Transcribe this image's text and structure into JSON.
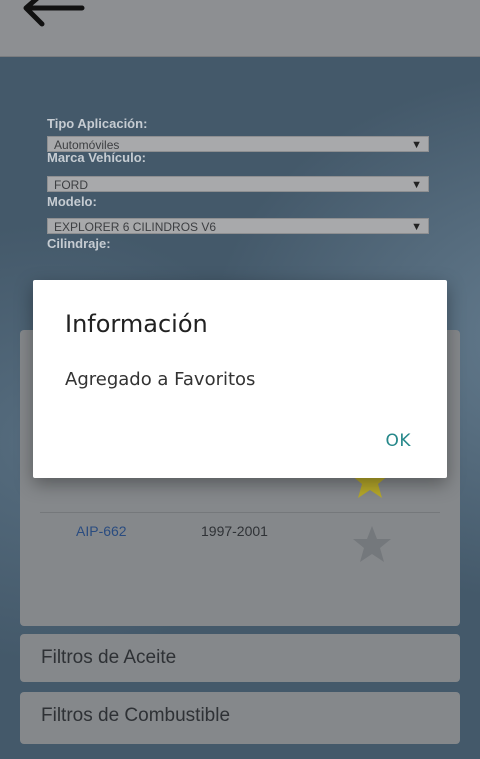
{
  "form": {
    "tipo_label": "Tipo Aplicación:",
    "tipo_value": "Automóviles",
    "marca_label": "Marca Vehículo:",
    "marca_value": "FORD",
    "modelo_label": "Modelo:",
    "modelo_value": "EXPLORER 6 CILINDROS V6",
    "cilindraje_label": "Cilindraje:",
    "arrow": "▼"
  },
  "results": {
    "rows": [
      {
        "code": "AIP-662",
        "years": "1997-2001",
        "favorite": false
      }
    ],
    "colors": {
      "star_active": "#b6a82a",
      "star_inactive": "#74787c"
    }
  },
  "categories": [
    {
      "label": "Filtros de Aceite"
    },
    {
      "label": "Filtros de Combustible"
    }
  ],
  "dialog": {
    "title": "Información",
    "message": "Agregado a Favoritos",
    "ok_label": "OK"
  }
}
